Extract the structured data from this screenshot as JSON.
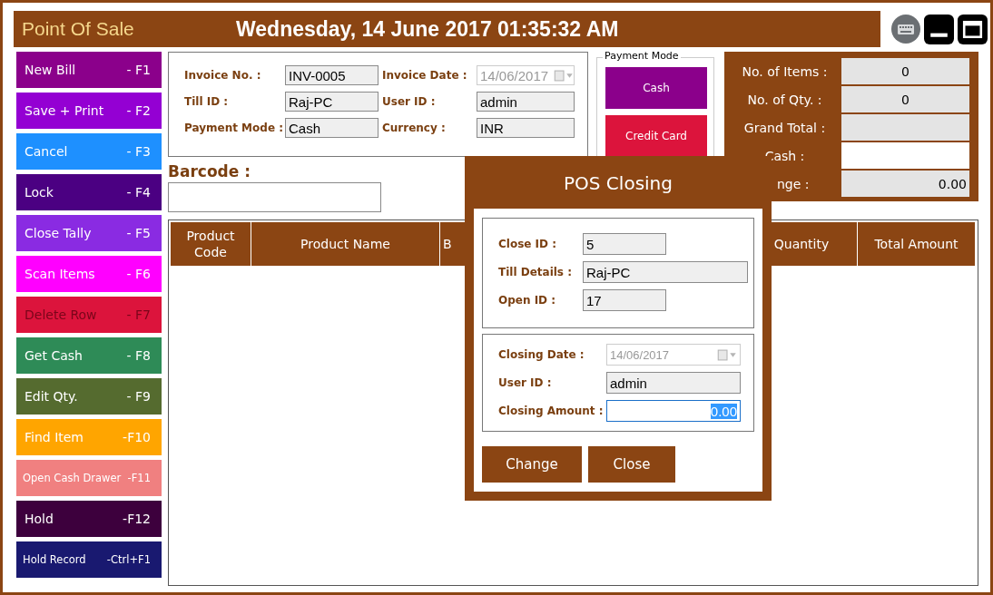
{
  "header": {
    "app_title": "Point Of Sale",
    "datetime": "Wednesday, 14 June 2017 01:35:32 AM"
  },
  "sidebar": {
    "buttons": [
      {
        "label": "New Bill",
        "shortcut": "- F1",
        "color": "#8b008b",
        "disabled": false,
        "kind": "normal"
      },
      {
        "label": "Save + Print",
        "shortcut": "- F2",
        "color": "#9400d3",
        "disabled": false,
        "kind": "normal"
      },
      {
        "label": "Cancel",
        "shortcut": "- F3",
        "color": "#1e90ff",
        "disabled": false,
        "kind": "normal"
      },
      {
        "label": "Lock",
        "shortcut": "- F4",
        "color": "#4b0082",
        "disabled": false,
        "kind": "normal"
      },
      {
        "label": "Close Tally",
        "shortcut": "- F5",
        "color": "#8a2be2",
        "disabled": false,
        "kind": "normal"
      },
      {
        "label": "Scan Items",
        "shortcut": "- F6",
        "color": "#ff00ff",
        "disabled": false,
        "kind": "normal"
      },
      {
        "label": "Delete Row",
        "shortcut": "- F7",
        "color": "#dc143c",
        "disabled": true,
        "kind": "normal"
      },
      {
        "label": "Get Cash",
        "shortcut": "- F8",
        "color": "#2e8b57",
        "disabled": false,
        "kind": "normal"
      },
      {
        "label": "Edit Qty.",
        "shortcut": "- F9",
        "color": "#556b2f",
        "disabled": false,
        "kind": "normal"
      },
      {
        "label": "Find Item",
        "shortcut": "-F10",
        "color": "#ffa500",
        "disabled": false,
        "kind": "normal"
      },
      {
        "label": "Open Cash Drawer",
        "shortcut": "-F11",
        "color": "#f08080",
        "disabled": false,
        "kind": "compact"
      },
      {
        "label": "Hold",
        "shortcut": "-F12",
        "color": "#3d003d",
        "disabled": false,
        "kind": "normal"
      },
      {
        "label": "Hold Record",
        "shortcut": "-Ctrl+F1",
        "color": "#191970",
        "disabled": false,
        "kind": "compact"
      }
    ]
  },
  "invoice": {
    "fields": [
      {
        "label": "Invoice No. :",
        "value": "INV-0005",
        "kind": "text",
        "disabled": false
      },
      {
        "label": "Invoice Date :",
        "value": "14/06/2017",
        "kind": "date",
        "disabled": true
      },
      {
        "label": "Till ID :",
        "value": "Raj-PC",
        "kind": "text",
        "disabled": false
      },
      {
        "label": "User ID :",
        "value": "admin",
        "kind": "text",
        "disabled": false
      },
      {
        "label": "Payment Mode :",
        "value": "Cash",
        "kind": "text",
        "disabled": false
      },
      {
        "label": "Currency :",
        "value": "INR",
        "kind": "text",
        "disabled": false
      }
    ]
  },
  "barcode": {
    "label": "Barcode :"
  },
  "payment_mode": {
    "legend": "Payment Mode",
    "buttons": [
      {
        "label": "Cash",
        "color": "#8b008b"
      },
      {
        "label": "Credit Card",
        "color": "#dc143c"
      }
    ]
  },
  "summary": {
    "rows": [
      {
        "label": "No. of Items :",
        "value": "0",
        "kind": "count",
        "editable": false
      },
      {
        "label": "No. of Qty. :",
        "value": "0",
        "kind": "count",
        "editable": false
      },
      {
        "label": "Grand Total :",
        "kind": "amount",
        "editable": false
      },
      {
        "label": "Cash :",
        "kind": "amount",
        "editable": true
      },
      {
        "label": "nge :",
        "value": "0.00",
        "kind": "amount",
        "editable": false
      }
    ]
  },
  "table": {
    "columns": [
      "Product Code",
      "Product Name",
      "B",
      "Quantity",
      "Total Amount"
    ]
  },
  "dialog": {
    "title": "POS Closing",
    "group_1": [
      {
        "label": "Close ID :",
        "value": "5",
        "kind": "short"
      },
      {
        "label": "Till Details :",
        "value": "Raj-PC",
        "kind": "long"
      },
      {
        "label": "Open ID :",
        "value": "17",
        "kind": "short"
      }
    ],
    "group_2": [
      {
        "label": "Closing Date :",
        "value": "14/06/2017",
        "kind": "date",
        "focused": false
      },
      {
        "label": "User ID :",
        "value": "admin",
        "kind": "text",
        "focused": false
      },
      {
        "label": "Closing Amount :",
        "value": "0.00",
        "kind": "amount",
        "focused": true
      }
    ],
    "buttons": [
      "Change",
      "Close"
    ]
  }
}
